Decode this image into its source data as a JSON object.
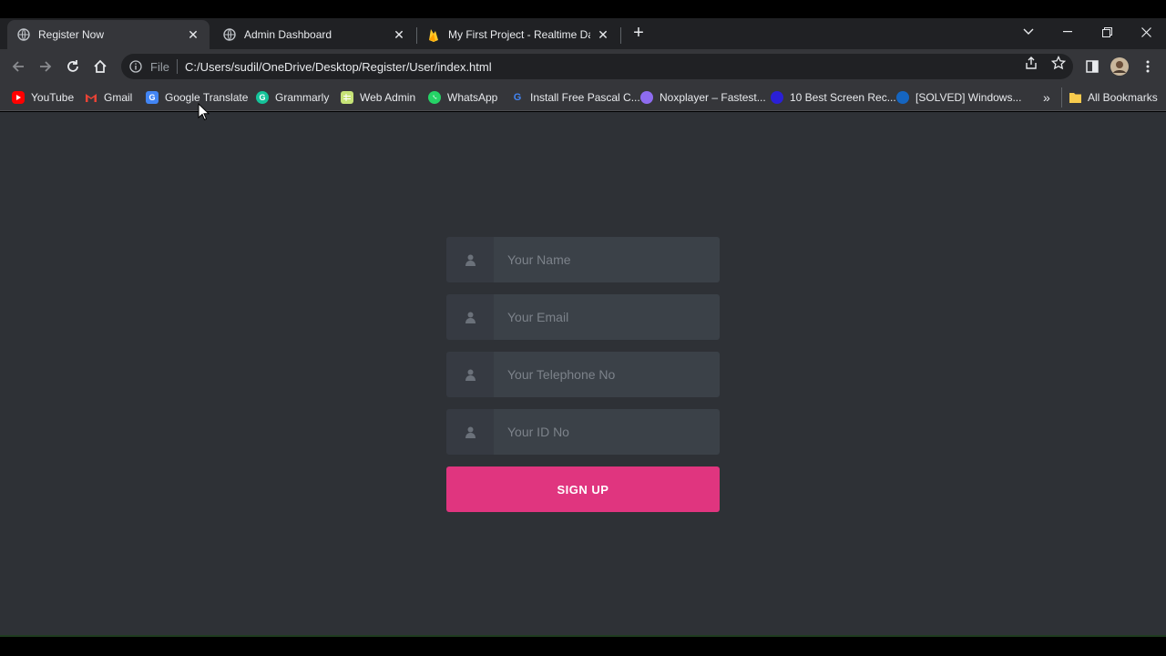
{
  "browser": {
    "tabs": [
      {
        "title": "Register Now",
        "icon": "globe-icon",
        "active": true
      },
      {
        "title": "Admin Dashboard",
        "icon": "globe-icon",
        "active": false
      },
      {
        "title": "My First Project - Realtime Datab",
        "icon": "firebase-icon",
        "active": false
      }
    ],
    "new_tab_label": "+",
    "address": {
      "scheme_label": "File",
      "url": "C:/Users/sudil/OneDrive/Desktop/Register/User/index.html"
    },
    "bookmarks": [
      {
        "label": "YouTube",
        "icon": "youtube-icon",
        "color": "#ff0000"
      },
      {
        "label": "Gmail",
        "icon": "gmail-icon",
        "color": "#ea4335"
      },
      {
        "label": "Google Translate",
        "icon": "translate-icon",
        "color": "#4285f4"
      },
      {
        "label": "Grammarly",
        "icon": "grammarly-icon",
        "color": "#15c39a"
      },
      {
        "label": "Web Admin",
        "icon": "sheet-icon",
        "color": "#c6e377"
      },
      {
        "label": "WhatsApp",
        "icon": "whatsapp-icon",
        "color": "#25d366"
      },
      {
        "label": "Install Free Pascal C...",
        "icon": "g-icon",
        "color": "#4285f4"
      },
      {
        "label": "Noxplayer – Fastest...",
        "icon": "nox-icon",
        "color": "#8e6cf0"
      },
      {
        "label": "10 Best Screen Rec...",
        "icon": "circle-icon",
        "color": "#2a1fd6"
      },
      {
        "label": "[SOLVED] Windows...",
        "icon": "windows-icon",
        "color": "#1565c0"
      }
    ],
    "overflow_label": "»",
    "all_bookmarks_label": "All Bookmarks"
  },
  "form": {
    "name_placeholder": "Your Name",
    "email_placeholder": "Your Email",
    "telephone_placeholder": "Your Telephone No",
    "id_placeholder": "Your ID No",
    "signup_label": "SIGN UP",
    "accent_color": "#e0357f"
  }
}
